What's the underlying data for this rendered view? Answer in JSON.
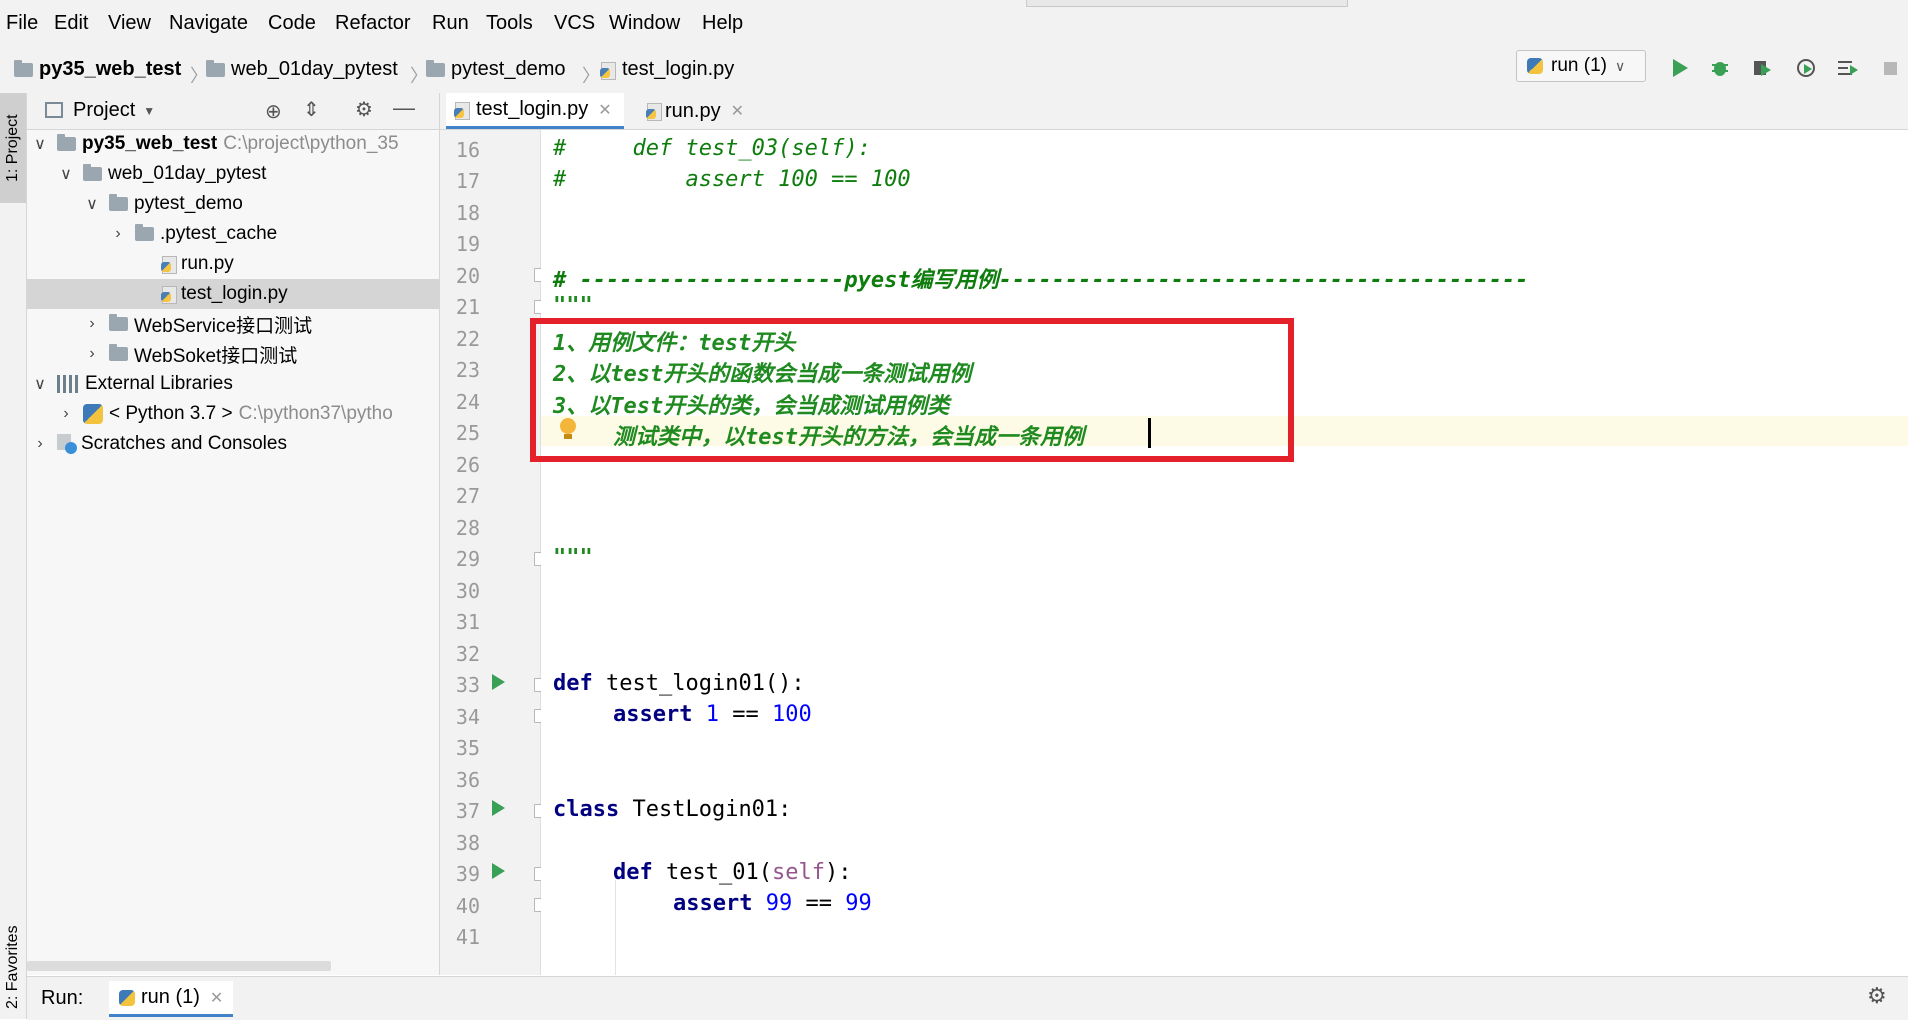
{
  "menu": [
    "File",
    "Edit",
    "View",
    "Navigate",
    "Code",
    "Refactor",
    "Run",
    "Tools",
    "VCS",
    "Window",
    "Help"
  ],
  "breadcrumb": [
    "py35_web_test",
    "web_01day_pytest",
    "pytest_demo",
    "test_login.py"
  ],
  "run_config": "run (1)",
  "left_stripe": {
    "project_tab": "1: Project",
    "favorites_tab": "2: Favorites"
  },
  "project_panel": {
    "title": "Project",
    "tree": [
      {
        "label": "py35_web_test",
        "path": "C:\\project\\python_35"
      },
      {
        "label": "web_01day_pytest"
      },
      {
        "label": "pytest_demo"
      },
      {
        "label": ".pytest_cache"
      },
      {
        "label": "run.py"
      },
      {
        "label": "test_login.py"
      },
      {
        "label": "WebService接口测试"
      },
      {
        "label": "WebSoket接口测试"
      },
      {
        "label": "External Libraries"
      },
      {
        "label": "< Python 3.7 >",
        "path": "C:\\python37\\pytho"
      },
      {
        "label": "Scratches and Consoles"
      }
    ]
  },
  "editor_tabs": [
    {
      "label": "test_login.py"
    },
    {
      "label": "run.py"
    }
  ],
  "code": {
    "line_numbers": [
      "16",
      "17",
      "18",
      "19",
      "20",
      "21",
      "22",
      "23",
      "24",
      "25",
      "26",
      "27",
      "28",
      "29",
      "30",
      "31",
      "32",
      "33",
      "34",
      "35",
      "36",
      "37",
      "38",
      "39",
      "40",
      "41"
    ],
    "l16": "#     def test_03(self):",
    "l17": "#         assert 100 == 100",
    "l20": "# --------------------pyest编写用例----------------------------------------",
    "l21": "\"\"\"",
    "l22": "1、用例文件：test开头",
    "l23": "2、以test开头的函数会当成一条测试用例",
    "l24": "3、以Test开头的类，会当成测试用例类",
    "l25": "测试类中，以test开头的方法，会当成一条用例",
    "l29": "\"\"\"",
    "l33_kw": "def",
    "l33_name": " test_login01():",
    "l34_kw": "assert",
    "l34_a": "1",
    "l34_op": " == ",
    "l34_b": "100",
    "l37_kw": "class",
    "l37_name": " TestLogin01:",
    "l39_kw": "def",
    "l39_name": " test_01(",
    "l39_self": "self",
    "l39_end": "):",
    "l40_kw": "assert",
    "l40_a": "99",
    "l40_op": " == ",
    "l40_b": "99"
  },
  "run_panel": {
    "label": "Run:",
    "tab": "run (1)"
  },
  "colors": {
    "accent": "#4083c9",
    "highlight_box": "#e4212a",
    "run_green": "#3aa055"
  }
}
